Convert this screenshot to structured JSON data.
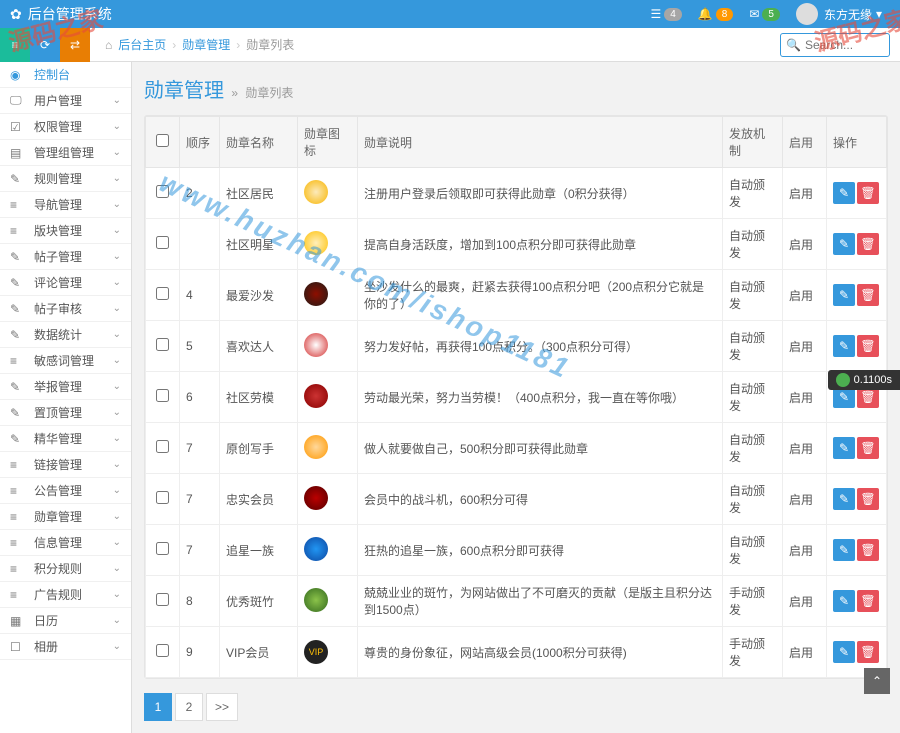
{
  "app_title": "后台管理系统",
  "header": {
    "notif_list_count": "4",
    "notif_bell_count": "8",
    "notif_mail_count": "5",
    "username": "东方无缘"
  },
  "search": {
    "placeholder": "Search..."
  },
  "breadcrumb": {
    "home": "后台主页",
    "sep": "›",
    "mid": "勋章管理",
    "current": "勋章列表"
  },
  "sidebar": {
    "items": [
      {
        "label": "控制台",
        "icon": "◉"
      },
      {
        "label": "用户管理",
        "icon": "🖵"
      },
      {
        "label": "权限管理",
        "icon": "☑"
      },
      {
        "label": "管理组管理",
        "icon": "▤"
      },
      {
        "label": "规则管理",
        "icon": "✎"
      },
      {
        "label": "导航管理",
        "icon": "≡"
      },
      {
        "label": "版块管理",
        "icon": "≡"
      },
      {
        "label": "帖子管理",
        "icon": "✎"
      },
      {
        "label": "评论管理",
        "icon": "✎"
      },
      {
        "label": "帖子审核",
        "icon": "✎"
      },
      {
        "label": "数据统计",
        "icon": "✎"
      },
      {
        "label": "敏感词管理",
        "icon": "≡"
      },
      {
        "label": "举报管理",
        "icon": "✎"
      },
      {
        "label": "置顶管理",
        "icon": "✎"
      },
      {
        "label": "精华管理",
        "icon": "✎"
      },
      {
        "label": "链接管理",
        "icon": "≡"
      },
      {
        "label": "公告管理",
        "icon": "≡"
      },
      {
        "label": "勋章管理",
        "icon": "≡"
      },
      {
        "label": "信息管理",
        "icon": "≡"
      },
      {
        "label": "积分规则",
        "icon": "≡"
      },
      {
        "label": "广告规则",
        "icon": "≡"
      },
      {
        "label": "日历",
        "icon": "▦"
      },
      {
        "label": "相册",
        "icon": "☐"
      }
    ]
  },
  "page": {
    "title": "勋章管理",
    "subtitle_sep": "»",
    "subtitle": "勋章列表"
  },
  "table": {
    "headers": {
      "order": "顺序",
      "name": "勋章名称",
      "icon": "勋章图标",
      "desc": "勋章说明",
      "mechanism": "发放机制",
      "enable": "启用",
      "action": "操作"
    },
    "rows": [
      {
        "order": "2",
        "name": "社区居民",
        "desc": "注册用户登录后领取即可获得此勋章（0积分获得）",
        "mechanism": "自动颁发",
        "enable": "启用"
      },
      {
        "order": "",
        "name": "社区明星",
        "desc": "提高自身活跃度，增加到100点积分即可获得此勋章",
        "mechanism": "自动颁发",
        "enable": "启用"
      },
      {
        "order": "4",
        "name": "最爱沙发",
        "desc": "坐沙发什么的最爽，赶紧去获得100点积分吧（200点积分它就是你的了）",
        "mechanism": "自动颁发",
        "enable": "启用"
      },
      {
        "order": "5",
        "name": "喜欢达人",
        "desc": "努力发好帖，再获得100点积分。（300点积分可得）",
        "mechanism": "自动颁发",
        "enable": "启用"
      },
      {
        "order": "6",
        "name": "社区劳模",
        "desc": "劳动最光荣，努力当劳模！（400点积分，我一直在等你哦）",
        "mechanism": "自动颁发",
        "enable": "启用"
      },
      {
        "order": "7",
        "name": "原创写手",
        "desc": "做人就要做自己，500积分即可获得此勋章",
        "mechanism": "自动颁发",
        "enable": "启用"
      },
      {
        "order": "7",
        "name": "忠实会员",
        "desc": "会员中的战斗机，600积分可得",
        "mechanism": "自动颁发",
        "enable": "启用"
      },
      {
        "order": "7",
        "name": "追星一族",
        "desc": "狂热的追星一族，600点积分即可获得",
        "mechanism": "自动颁发",
        "enable": "启用"
      },
      {
        "order": "8",
        "name": "优秀斑竹",
        "desc": "兢兢业业的斑竹，为网站做出了不可磨灭的贡献（是版主且积分达到1500点）",
        "mechanism": "手动颁发",
        "enable": "启用"
      },
      {
        "order": "9",
        "name": "VIP会员",
        "desc": "尊贵的身份象征，网站高级会员(1000积分可获得)",
        "mechanism": "手动颁发",
        "enable": "启用"
      }
    ],
    "vip_badge_text": "VIP"
  },
  "pagination": {
    "page1": "1",
    "page2": "2",
    "next": ">>"
  },
  "debug": {
    "timer": "0.1100s"
  },
  "watermark": {
    "stamp1": "源码之家",
    "stamp2": "源码之家",
    "url": "www.huzhan.com/ishop1181"
  }
}
